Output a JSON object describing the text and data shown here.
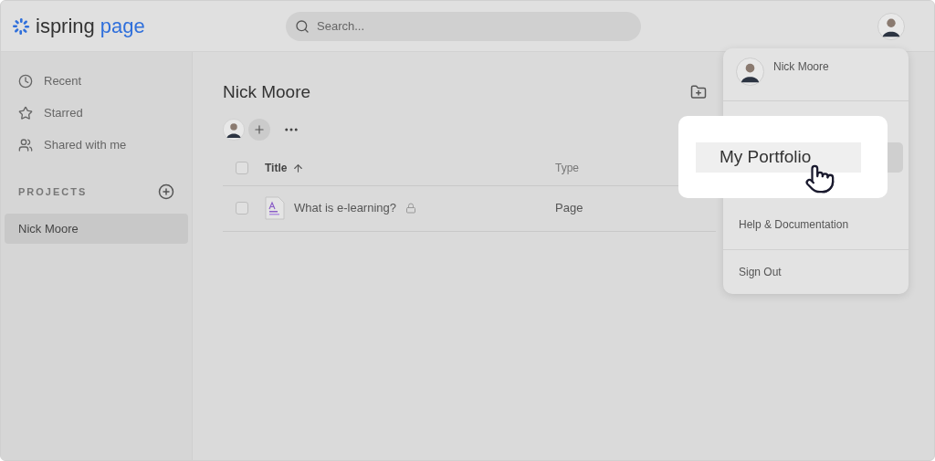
{
  "logo": {
    "word_1": "ispring",
    "word_2": "page"
  },
  "search": {
    "placeholder": "Search..."
  },
  "sidebar": {
    "items": [
      {
        "kind": "recent",
        "label": "Recent",
        "selected": false
      },
      {
        "kind": "starred",
        "label": "Starred",
        "selected": false
      },
      {
        "kind": "shared",
        "label": "Shared with me",
        "selected": false
      }
    ],
    "projects_heading": "PROJECTS",
    "projects": [
      {
        "label": "Nick Moore",
        "selected": true
      }
    ]
  },
  "main": {
    "title": "Nick Moore",
    "table": {
      "header_checked": false,
      "columns": [
        "Title",
        "Type"
      ],
      "rows": [
        {
          "title": "What is e-learning?",
          "locked": true,
          "type": "Page",
          "checked": false
        }
      ]
    }
  },
  "menu": {
    "user_name": "Nick Moore",
    "items": [
      {
        "label": "My Portfolio",
        "selected": true
      },
      {
        "label": "Help & Documentation",
        "selected": false
      },
      {
        "label": "Sign Out",
        "selected": false
      }
    ]
  }
}
